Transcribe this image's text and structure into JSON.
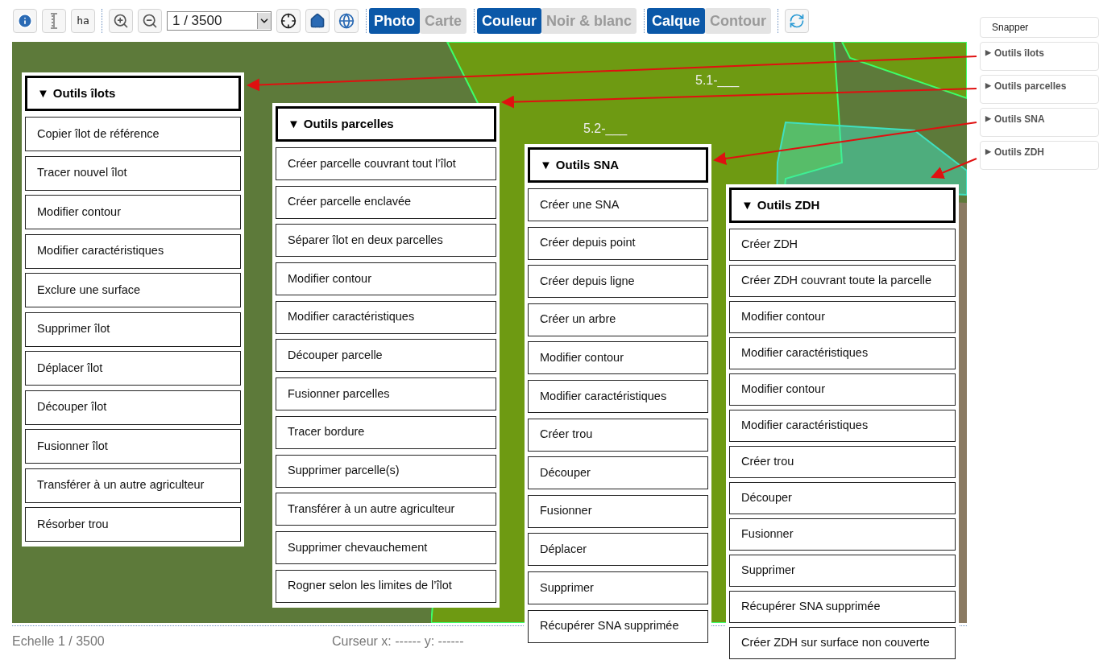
{
  "toolbar": {
    "scale_select": {
      "value": "1 / 3500"
    },
    "area_label": "ha",
    "toggle_groups": [
      [
        {
          "label": "Photo",
          "selected": true
        },
        {
          "label": "Carte",
          "selected": false
        }
      ],
      [
        {
          "label": "Couleur",
          "selected": true
        },
        {
          "label": "Noir & blanc",
          "selected": false
        }
      ],
      [
        {
          "label": "Calque",
          "selected": true
        },
        {
          "label": "Contour",
          "selected": false
        }
      ]
    ]
  },
  "map": {
    "labels": [
      "5.1-___",
      "5.2-___"
    ]
  },
  "sidebar": {
    "snapper": "Snapper",
    "items": [
      {
        "marker": "▶",
        "label": "Outils îlots"
      },
      {
        "marker": "▶",
        "label": "Outils parcelles"
      },
      {
        "marker": "▶",
        "label": "Outils SNA"
      },
      {
        "marker": "▶",
        "label": "Outils ZDH"
      }
    ]
  },
  "panels": [
    {
      "marker": "▼",
      "title": "Outils îlots",
      "items": [
        "Copier îlot de référence",
        "Tracer nouvel îlot",
        "Modifier contour",
        "Modifier caractéristiques",
        "Exclure une surface",
        "Supprimer îlot",
        "Déplacer îlot",
        "Découper îlot",
        "Fusionner îlot",
        "Transférer à un autre agriculteur",
        "Résorber trou"
      ]
    },
    {
      "marker": "▼",
      "title": "Outils parcelles",
      "items": [
        "Créer parcelle couvrant tout l’îlot",
        "Créer parcelle enclavée",
        "Séparer îlot en deux parcelles",
        "Modifier contour",
        "Modifier caractéristiques",
        "Découper parcelle",
        "Fusionner parcelles",
        "Tracer bordure",
        "Supprimer parcelle(s)",
        "Transférer à un autre agriculteur",
        "Supprimer chevauchement",
        "Rogner selon les limites  de  l’îlot"
      ]
    },
    {
      "marker": "▼",
      "title": "Outils SNA",
      "items": [
        "Créer une SNA",
        "Créer depuis point",
        "Créer depuis ligne",
        "Créer un arbre",
        "Modifier contour",
        "Modifier caractéristiques",
        "Créer trou",
        "Découper",
        "Fusionner",
        "Déplacer",
        "Supprimer",
        "Récupérer SNA supprimée"
      ]
    },
    {
      "marker": "▼",
      "title": "Outils ZDH",
      "items": [
        "Créer ZDH",
        "Créer ZDH couvrant toute la parcelle",
        "Modifier contour",
        "Modifier caractéristiques",
        "Modifier contour",
        "Modifier caractéristiques",
        "Créer trou",
        "Découper",
        "Fusionner",
        "Supprimer",
        "Récupérer SNA supprimée",
        "Créer ZDH sur surface non couverte"
      ]
    }
  ],
  "status_bar": {
    "scale": "Echelle 1 / 3500",
    "cursor": "Curseur x: ------ y: ------"
  }
}
